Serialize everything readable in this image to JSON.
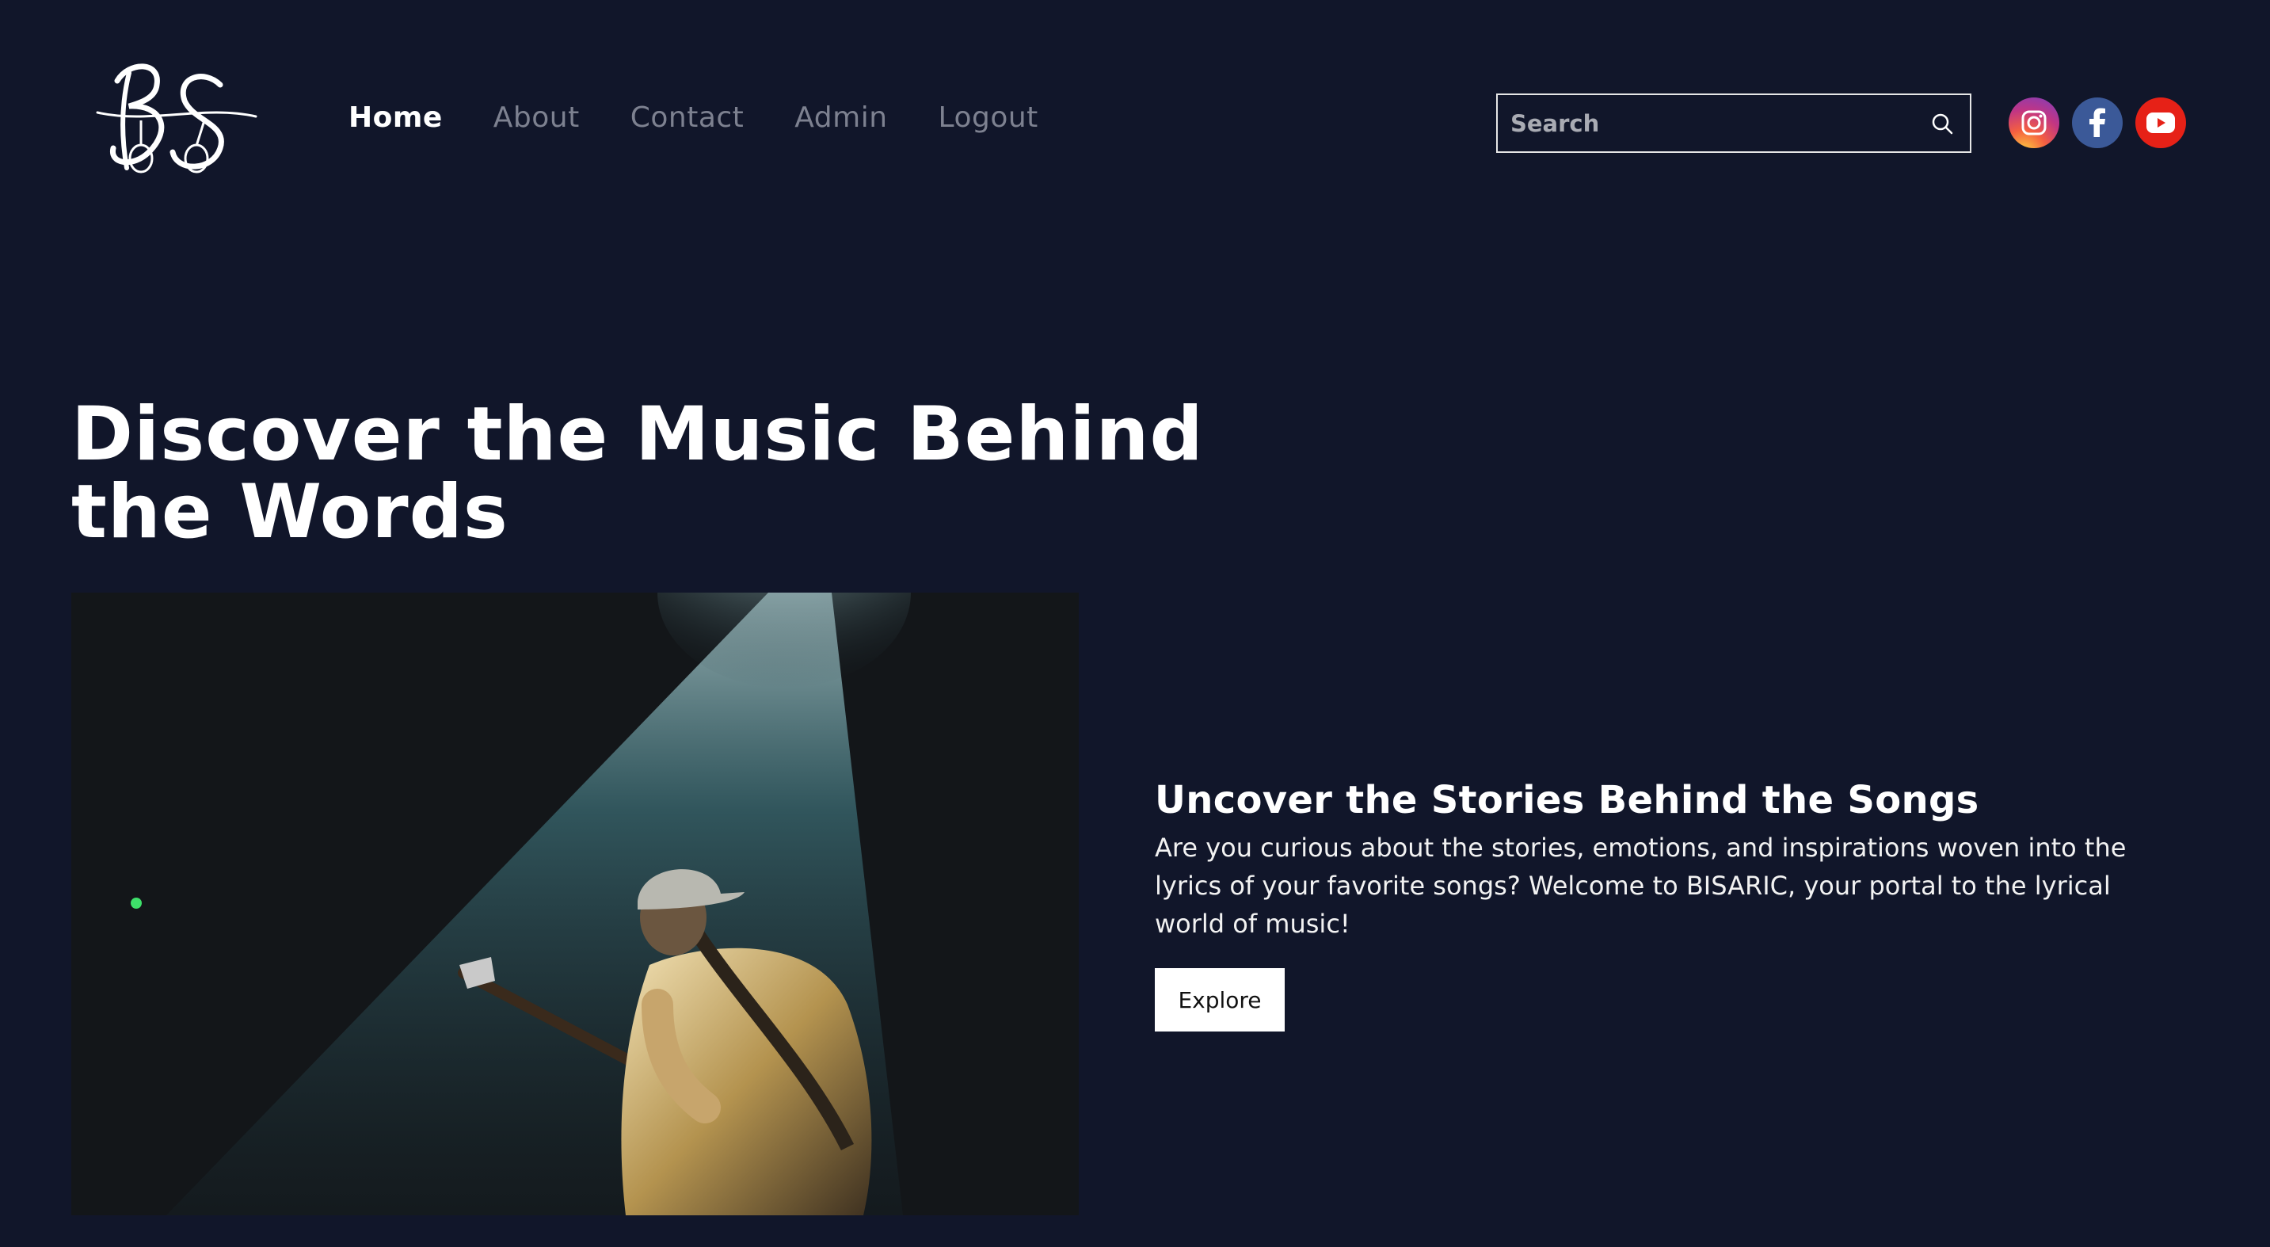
{
  "logo": {
    "text": "BS",
    "icon": "guitar-monogram-logo"
  },
  "nav": {
    "items": [
      {
        "label": "Home",
        "active": true
      },
      {
        "label": "About",
        "active": false
      },
      {
        "label": "Contact",
        "active": false
      },
      {
        "label": "Admin",
        "active": false
      },
      {
        "label": "Logout",
        "active": false
      }
    ]
  },
  "search": {
    "placeholder": "Search",
    "icon": "search-icon"
  },
  "socials": [
    {
      "name": "instagram",
      "icon": "instagram-icon",
      "color": "#c13584"
    },
    {
      "name": "facebook",
      "icon": "facebook-icon",
      "color": "#3b5998"
    },
    {
      "name": "youtube",
      "icon": "youtube-icon",
      "color": "#e62117"
    }
  ],
  "hero": {
    "title": "Discover the Music Behind the Words",
    "image": "guitarist-under-spotlight-photo",
    "subheading": "Uncover the Stories Behind the Songs",
    "body": "Are you curious about the stories, emotions, and inspirations woven into the lyrics of your favorite songs? Welcome to BISARIC, your portal to the lyrical world of music!",
    "cta_label": "Explore"
  },
  "colors": {
    "background": "#11162a",
    "nav_inactive": "#7d8190",
    "text": "#ffffff"
  }
}
